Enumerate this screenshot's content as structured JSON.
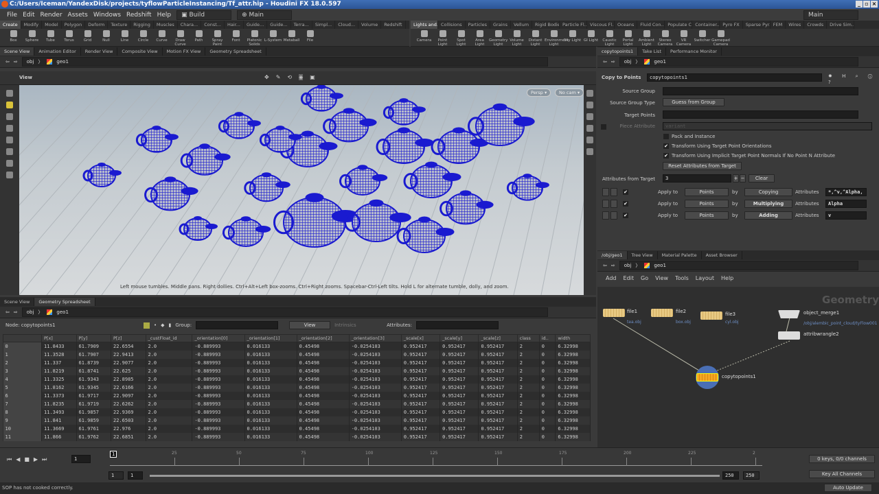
{
  "title": "C:/Users/Iceman/YandexDisk/projects/tyflowParticleInstancing/Tf_attr.hip - Houdini FX 18.0.597",
  "menu": [
    "File",
    "Edit",
    "Render",
    "Assets",
    "Windows",
    "Redshift",
    "Help"
  ],
  "desktop_left": "Build",
  "desktop_right": "Main",
  "shelf_left_tabs": [
    "Create",
    "Modify",
    "Model",
    "Polygon",
    "Deform",
    "Texture",
    "Rigging",
    "Muscles",
    "Chara...",
    "Const...",
    "Hair...",
    "Guide...",
    "Guide...",
    "Terra...",
    "Simpl...",
    "Cloud...",
    "Volume",
    "Redshift"
  ],
  "shelf_left_tools": [
    "Box",
    "Sphere",
    "Tube",
    "Torus",
    "Grid",
    "Null",
    "Line",
    "Circle",
    "Curve",
    "Draw Curve",
    "Path",
    "Spray Paint",
    "Font",
    "Platonic Solids",
    "L-System",
    "Metaball",
    "File"
  ],
  "shelf_right_tabs": [
    "Lights and...",
    "Collisions",
    "Particles",
    "Grains",
    "Vellum",
    "Rigid Bodies",
    "Particle Fl...",
    "Viscous Fl...",
    "Oceans",
    "Fluid Con...",
    "Populate C...",
    "Container...",
    "Pyro FX",
    "Sparse Pyr...",
    "FEM",
    "Wires",
    "Crowds",
    "Drive Sim..."
  ],
  "shelf_right_tools": [
    "Camera",
    "Point Light",
    "Spot Light",
    "Area Light",
    "Geometry Light",
    "Volume Light",
    "Distant Light",
    "Environment Light",
    "Sky Light",
    "GI Light",
    "Caustic Light",
    "Portal Light",
    "Ambient Light",
    "Stereo Camera",
    "VR Camera",
    "Switcher",
    "Gamepad Camera"
  ],
  "top_left_tabs": [
    "Scene View",
    "Animation Editor",
    "Render View",
    "Composite View",
    "Motion FX View",
    "Geometry Spreadsheet"
  ],
  "path": {
    "obj": "obj",
    "geo": "geo1"
  },
  "viewport": {
    "label": "View",
    "persp": "Persp ▾",
    "cam": "No cam ▾",
    "hint": "Left mouse tumbles. Middle pans. Right dollies. Ctrl+Alt+Left box-zooms. Ctrl+Right zooms. Spacebar-Ctrl-Left tilts. Hold L for alternate tumble, dolly, and zoom.",
    "teapot_color": "#1a1ad0"
  },
  "bottom_left_tabs": [
    "Scene View",
    "Geometry Spreadsheet"
  ],
  "spreadsheet": {
    "node": "Node: copytopoints1",
    "group_label": "Group:",
    "view": "View",
    "intrinsics": "Intrinsics",
    "attributes_label": "Attributes:",
    "columns": [
      "",
      "P[x]",
      "P[y]",
      "P[z]",
      "_custFloat_id",
      "_orientation[0]",
      "_orientation[1]",
      "_orientation[2]",
      "_orientation[3]",
      "_scale[x]",
      "_scale[y]",
      "_scale[z]",
      "class",
      "id..",
      "width"
    ],
    "rows": [
      [
        "0",
        "11.8433",
        "61.7909",
        "22.6554",
        "2.0",
        "-0.889993",
        "0.016133",
        "0.45498",
        "-0.0254103",
        "0.952417",
        "0.952417",
        "0.952417",
        "2",
        "0",
        "6.32998"
      ],
      [
        "1",
        "11.3528",
        "61.7907",
        "22.9413",
        "2.0",
        "-0.889993",
        "0.016133",
        "0.45498",
        "-0.0254103",
        "0.952417",
        "0.952417",
        "0.952417",
        "2",
        "0",
        "6.32998"
      ],
      [
        "2",
        "11.337",
        "61.8739",
        "22.9077",
        "2.0",
        "-0.889993",
        "0.016133",
        "0.45498",
        "-0.0254103",
        "0.952417",
        "0.952417",
        "0.952417",
        "2",
        "0",
        "6.32998"
      ],
      [
        "3",
        "11.8219",
        "61.8741",
        "22.625",
        "2.0",
        "-0.889993",
        "0.016133",
        "0.45498",
        "-0.0254103",
        "0.952417",
        "0.952417",
        "0.952417",
        "2",
        "0",
        "6.32998"
      ],
      [
        "4",
        "11.3325",
        "61.9343",
        "22.8985",
        "2.0",
        "-0.889993",
        "0.016133",
        "0.45498",
        "-0.0254103",
        "0.952417",
        "0.952417",
        "0.952417",
        "2",
        "0",
        "6.32998"
      ],
      [
        "5",
        "11.8162",
        "61.9345",
        "22.6166",
        "2.0",
        "-0.889993",
        "0.016133",
        "0.45498",
        "-0.0254103",
        "0.952417",
        "0.952417",
        "0.952417",
        "2",
        "0",
        "6.32998"
      ],
      [
        "6",
        "11.3373",
        "61.9717",
        "22.9097",
        "2.0",
        "-0.889993",
        "0.016133",
        "0.45498",
        "-0.0254103",
        "0.952417",
        "0.952417",
        "0.952417",
        "2",
        "0",
        "6.32998"
      ],
      [
        "7",
        "11.8235",
        "61.9719",
        "22.6262",
        "2.0",
        "-0.889993",
        "0.016133",
        "0.45498",
        "-0.0254103",
        "0.952417",
        "0.952417",
        "0.952417",
        "2",
        "0",
        "6.32998"
      ],
      [
        "8",
        "11.3493",
        "61.9857",
        "22.9369",
        "2.0",
        "-0.889993",
        "0.016133",
        "0.45498",
        "-0.0254103",
        "0.952417",
        "0.952417",
        "0.952417",
        "2",
        "0",
        "6.32998"
      ],
      [
        "9",
        "11.841",
        "61.9859",
        "22.6503",
        "2.0",
        "-0.889993",
        "0.016133",
        "0.45498",
        "-0.0254103",
        "0.952417",
        "0.952417",
        "0.952417",
        "2",
        "0",
        "6.32998"
      ],
      [
        "10",
        "11.3669",
        "61.9761",
        "22.976",
        "2.0",
        "-0.889993",
        "0.016133",
        "0.45498",
        "-0.0254103",
        "0.952417",
        "0.952417",
        "0.952417",
        "2",
        "0",
        "6.32998"
      ],
      [
        "11",
        "11.866",
        "61.9762",
        "22.6851",
        "2.0",
        "-0.889993",
        "0.016133",
        "0.45498",
        "-0.0254103",
        "0.952417",
        "0.952417",
        "0.952417",
        "2",
        "0",
        "6.32998"
      ]
    ]
  },
  "top_right_tabs": [
    "copytopoints1",
    "Take List",
    "Performance Monitor"
  ],
  "params": {
    "type": "Copy to Points",
    "name": "copytopoints1",
    "source_group": "Source Group",
    "source_group_type": "Source Group Type",
    "source_group_type_value": "Guess from Group",
    "target_points": "Target Points",
    "piece_attribute": "Piece Attribute",
    "piece_attribute_value": "variant",
    "pack": "Pack and Instance",
    "transform_orient": "Transform Using Target Point Orientations",
    "transform_normals": "Transform Using Implicit Target Point Normals If No Point N Attribute",
    "reset": "Reset Attributes from Target",
    "attrs_from_target": "Attributes from Target",
    "attrs_count": "3",
    "clear": "Clear",
    "apply_to": "Apply to",
    "by": "by",
    "attributes": "Attributes",
    "rules": [
      {
        "to": "Points",
        "by": "Copying",
        "attrs": "*,^v,^Alpha,"
      },
      {
        "to": "Points",
        "by": "Multiplying",
        "attrs": "Alpha"
      },
      {
        "to": "Points",
        "by": "Adding",
        "attrs": "v"
      }
    ]
  },
  "bottom_right_tabs": [
    "/obj/geo1",
    "Tree View",
    "Material Palette",
    "Asset Browser"
  ],
  "network_menu": [
    "Add",
    "Edit",
    "Go",
    "View",
    "Tools",
    "Layout",
    "Help"
  ],
  "network": {
    "context": "Geometry",
    "nodes": {
      "file1": "file1",
      "file1_sub": "tea.obj",
      "file2": "file2",
      "file2_sub": "box.obj",
      "file3": "file3",
      "file3_sub": "cyl.obj",
      "om": "object_merge1",
      "om_sub": "/obj/alembic_point_cloud/tyFlow001",
      "aw": "attribwrangle2",
      "ctp": "copytopoints1"
    }
  },
  "timeline": {
    "frame": "1",
    "ticks": [
      "25",
      "50",
      "75",
      "100",
      "125",
      "150",
      "175",
      "200",
      "225",
      "2"
    ],
    "start": "1",
    "start2": "1",
    "end": "250",
    "end2": "250",
    "keys": "0 keys, 0/0 channels",
    "key_all": "Key All Channels"
  },
  "status": {
    "message": "SOP has not cooked correctly.",
    "update": "Auto Update"
  }
}
